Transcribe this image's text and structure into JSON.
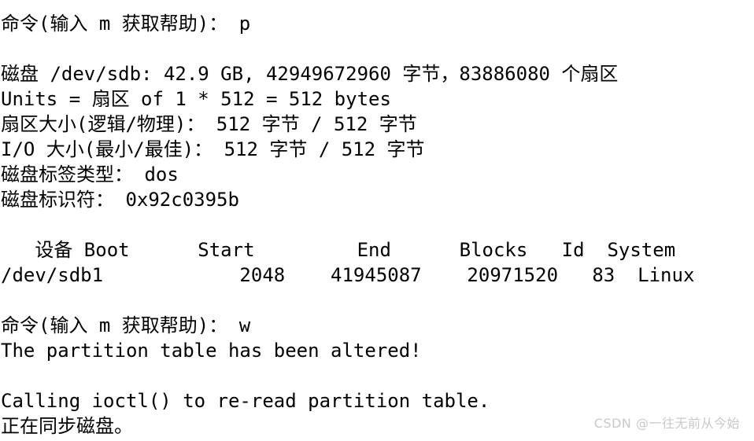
{
  "terminal": {
    "background_color": "#ffffff",
    "text_color": "#000000",
    "lines": [
      {
        "id": "prompt-print",
        "text": "命令(输入 m 获取帮助)： p"
      },
      {
        "id": "blank-1",
        "text": ""
      },
      {
        "id": "disk-summary",
        "text": "磁盘 /dev/sdb: 42.9 GB, 42949672960 字节，83886080 个扇区"
      },
      {
        "id": "units",
        "text": "Units = 扇区 of 1 * 512 = 512 bytes"
      },
      {
        "id": "sector-size",
        "text": "扇区大小(逻辑/物理)： 512 字节 / 512 字节"
      },
      {
        "id": "io-size",
        "text": "I/O 大小(最小/最佳)： 512 字节 / 512 字节"
      },
      {
        "id": "disk-label-type",
        "text": "磁盘标签类型： dos"
      },
      {
        "id": "disk-identifier",
        "text": "磁盘标识符： 0x92c0395b"
      },
      {
        "id": "blank-2",
        "text": ""
      },
      {
        "id": "partition-table-header",
        "text": "   设备 Boot      Start         End      Blocks   Id  System"
      },
      {
        "id": "partition-row-sdb1",
        "text": "/dev/sdb1            2048    41945087    20971520   83  Linux"
      },
      {
        "id": "blank-3",
        "text": ""
      },
      {
        "id": "prompt-write",
        "text": "命令(输入 m 获取帮助)： w"
      },
      {
        "id": "altered-message",
        "text": "The partition table has been altered!"
      },
      {
        "id": "blank-4",
        "text": ""
      },
      {
        "id": "ioctl-message",
        "text": "Calling ioctl() to re-read partition table."
      },
      {
        "id": "syncing-message",
        "text": "正在同步磁盘。"
      }
    ],
    "partition_table": {
      "columns": [
        "设备",
        "Boot",
        "Start",
        "End",
        "Blocks",
        "Id",
        "System"
      ],
      "rows": [
        {
          "device": "/dev/sdb1",
          "boot": "",
          "start": "2048",
          "end": "41945087",
          "blocks": "20971520",
          "id": "83",
          "system": "Linux"
        }
      ]
    },
    "disk_info": {
      "device": "/dev/sdb",
      "size_human": "42.9 GB",
      "size_bytes": "42949672960",
      "sectors": "83886080",
      "units": "扇区 of 1 * 512 = 512 bytes",
      "sector_size_logical": "512 字节",
      "sector_size_physical": "512 字节",
      "io_size_min": "512 字节",
      "io_size_optimal": "512 字节",
      "disklabel_type": "dos",
      "disk_identifier": "0x92c0395b"
    },
    "commands_entered": [
      "p",
      "w"
    ]
  },
  "watermark": {
    "text": "CSDN @一往无前从今始",
    "color": "#c8c8c8"
  }
}
